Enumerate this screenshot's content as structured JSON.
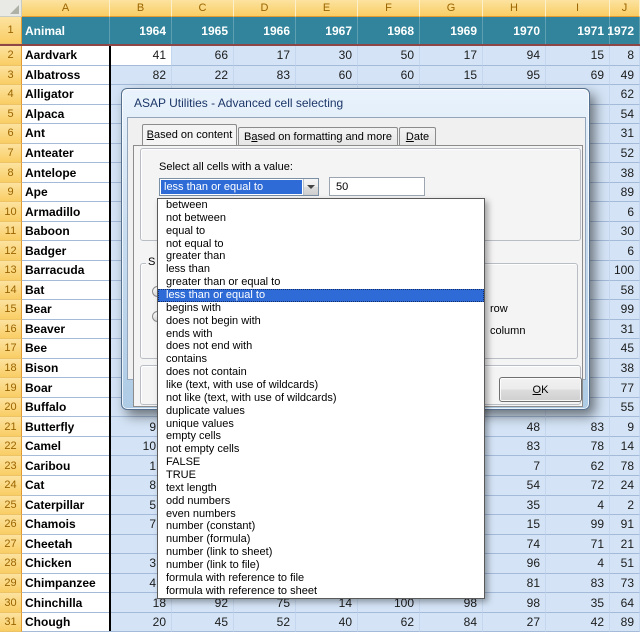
{
  "sheet": {
    "col_letters": [
      "A",
      "B",
      "C",
      "D",
      "E",
      "F",
      "G",
      "H",
      "I",
      "J"
    ],
    "title_row": {
      "num": "1",
      "label": "Animal",
      "years": [
        "1964",
        "1965",
        "1966",
        "1967",
        "1968",
        "1969",
        "1970",
        "1971",
        "1972"
      ]
    },
    "rows": [
      {
        "num": "2",
        "name": "Aardvark",
        "peek": false,
        "cells": [
          "41",
          "66",
          "17",
          "30",
          "50",
          "17",
          "94",
          "15",
          "8"
        ]
      },
      {
        "num": "3",
        "name": "Albatross",
        "peek": false,
        "cells": [
          "82",
          "22",
          "83",
          "60",
          "60",
          "15",
          "95",
          "69",
          "49"
        ]
      },
      {
        "num": "4",
        "name": "Alligator",
        "peek": false,
        "cells": [
          "",
          "",
          "",
          "",
          "",
          "",
          "",
          "",
          "62"
        ]
      },
      {
        "num": "5",
        "name": "Alpaca",
        "peek": false,
        "cells": [
          "",
          "",
          "",
          "",
          "",
          "",
          "",
          "",
          "54"
        ]
      },
      {
        "num": "6",
        "name": "Ant",
        "peek": false,
        "cells": [
          "",
          "",
          "",
          "",
          "",
          "",
          "",
          "",
          "31"
        ]
      },
      {
        "num": "7",
        "name": "Anteater",
        "peek": false,
        "cells": [
          "",
          "",
          "",
          "",
          "",
          "",
          "",
          "",
          "52"
        ]
      },
      {
        "num": "8",
        "name": "Antelope",
        "peek": false,
        "cells": [
          "",
          "",
          "",
          "",
          "",
          "",
          "",
          "",
          "38"
        ]
      },
      {
        "num": "9",
        "name": "Ape",
        "peek": false,
        "cells": [
          "",
          "",
          "",
          "",
          "",
          "",
          "",
          "",
          "89"
        ]
      },
      {
        "num": "10",
        "name": "Armadillo",
        "peek": false,
        "cells": [
          "",
          "",
          "",
          "",
          "",
          "",
          "",
          "",
          "6"
        ]
      },
      {
        "num": "11",
        "name": "Baboon",
        "peek": false,
        "cells": [
          "",
          "",
          "",
          "",
          "",
          "",
          "",
          "",
          "30"
        ]
      },
      {
        "num": "12",
        "name": "Badger",
        "peek": false,
        "cells": [
          "",
          "",
          "",
          "",
          "",
          "",
          "",
          "",
          "6"
        ]
      },
      {
        "num": "13",
        "name": "Barracuda",
        "peek": false,
        "cells": [
          "",
          "",
          "",
          "",
          "",
          "",
          "",
          "",
          "100"
        ]
      },
      {
        "num": "14",
        "name": "Bat",
        "peek": false,
        "cells": [
          "",
          "",
          "",
          "",
          "",
          "",
          "",
          "",
          "58"
        ]
      },
      {
        "num": "15",
        "name": "Bear",
        "peek": false,
        "cells": [
          "",
          "",
          "",
          "",
          "",
          "",
          "",
          "",
          "99"
        ]
      },
      {
        "num": "16",
        "name": "Beaver",
        "peek": false,
        "cells": [
          "",
          "",
          "",
          "",
          "",
          "",
          "",
          "",
          "31"
        ]
      },
      {
        "num": "17",
        "name": "Bee",
        "peek": false,
        "cells": [
          "",
          "",
          "",
          "",
          "",
          "",
          "",
          "",
          "45"
        ]
      },
      {
        "num": "18",
        "name": "Bison",
        "peek": false,
        "cells": [
          "",
          "",
          "",
          "",
          "",
          "",
          "",
          "",
          "38"
        ]
      },
      {
        "num": "19",
        "name": "Boar",
        "peek": false,
        "cells": [
          "",
          "",
          "",
          "",
          "",
          "",
          "",
          "",
          "77"
        ]
      },
      {
        "num": "20",
        "name": "Buffalo",
        "peek": false,
        "cells": [
          "",
          "",
          "",
          "",
          "",
          "",
          "",
          "",
          "55"
        ]
      },
      {
        "num": "21",
        "name": "Butterfly",
        "peek": true,
        "cells": [
          "9",
          "",
          "",
          "",
          "",
          "",
          "48",
          "83",
          "9"
        ]
      },
      {
        "num": "22",
        "name": "Camel",
        "peek": true,
        "cells": [
          "10",
          "",
          "",
          "",
          "",
          "",
          "83",
          "78",
          "14"
        ]
      },
      {
        "num": "23",
        "name": "Caribou",
        "peek": true,
        "cells": [
          "1",
          "",
          "",
          "",
          "",
          "",
          "7",
          "62",
          "78"
        ]
      },
      {
        "num": "24",
        "name": "Cat",
        "peek": true,
        "cells": [
          "8",
          "",
          "",
          "",
          "",
          "",
          "54",
          "72",
          "24"
        ]
      },
      {
        "num": "25",
        "name": "Caterpillar",
        "peek": true,
        "cells": [
          "5",
          "",
          "",
          "",
          "",
          "",
          "35",
          "4",
          "2"
        ]
      },
      {
        "num": "26",
        "name": "Chamois",
        "peek": true,
        "cells": [
          "7",
          "",
          "",
          "",
          "",
          "",
          "15",
          "99",
          "91"
        ]
      },
      {
        "num": "27",
        "name": "Cheetah",
        "peek": true,
        "cells": [
          "",
          "",
          "",
          "",
          "",
          "",
          "74",
          "71",
          "21"
        ]
      },
      {
        "num": "28",
        "name": "Chicken",
        "peek": true,
        "cells": [
          "3",
          "",
          "",
          "",
          "",
          "",
          "96",
          "4",
          "51"
        ]
      },
      {
        "num": "29",
        "name": "Chimpanzee",
        "peek": true,
        "cells": [
          "4",
          "",
          "",
          "",
          "",
          "",
          "81",
          "83",
          "73"
        ]
      },
      {
        "num": "30",
        "name": "Chinchilla",
        "peek": false,
        "cells": [
          "18",
          "92",
          "75",
          "14",
          "100",
          "98",
          "98",
          "35",
          "64"
        ]
      },
      {
        "num": "31",
        "name": "Chough",
        "peek": false,
        "cells": [
          "20",
          "45",
          "52",
          "40",
          "62",
          "84",
          "27",
          "42",
          "89"
        ]
      }
    ],
    "active_cell": "B2"
  },
  "dialog": {
    "title": "ASAP Utilities - Advanced cell selecting",
    "tabs": [
      {
        "label": "Based on content",
        "accel": "B",
        "selected": true
      },
      {
        "label": "Based on formatting and more",
        "accel": "a",
        "selected": false
      },
      {
        "label": "Date",
        "accel": "D",
        "selected": false
      }
    ],
    "content_label": "Select all cells with a value:",
    "combo_value": "less than or equal to",
    "field_value": "50",
    "group_label_fragment": "S",
    "radio_row_fragment": "row",
    "radio_column_fragment": "column",
    "ok_button": {
      "label": "OK",
      "accel": "O"
    }
  },
  "dropdown": {
    "selected_index": 7,
    "items": [
      "between",
      "not between",
      "equal to",
      "not equal to",
      "greater than",
      "less than",
      "greater than or equal to",
      "less than or equal to",
      "begins with",
      "does not begin with",
      "ends with",
      "does not end with",
      "contains",
      "does not contain",
      "like (text, with use of wildcards)",
      "not like (text, with use of wildcards)",
      "duplicate values",
      "unique values",
      "empty cells",
      "not empty cells",
      "FALSE",
      "TRUE",
      "text length",
      "odd numbers",
      "even numbers",
      "number (constant)",
      "number (formula)",
      "number (link to sheet)",
      "number (link to file)",
      "formula with reference to file",
      "formula with reference to sheet"
    ]
  },
  "accent_colors": {
    "header_gold": "#F9CD64",
    "header_text": "#9A6400",
    "year_row_teal": "#31849B",
    "year_row_border": "#8F4646",
    "selected_cells_blue": "#D4E4F6",
    "highlight_blue": "#2E6BD6"
  }
}
